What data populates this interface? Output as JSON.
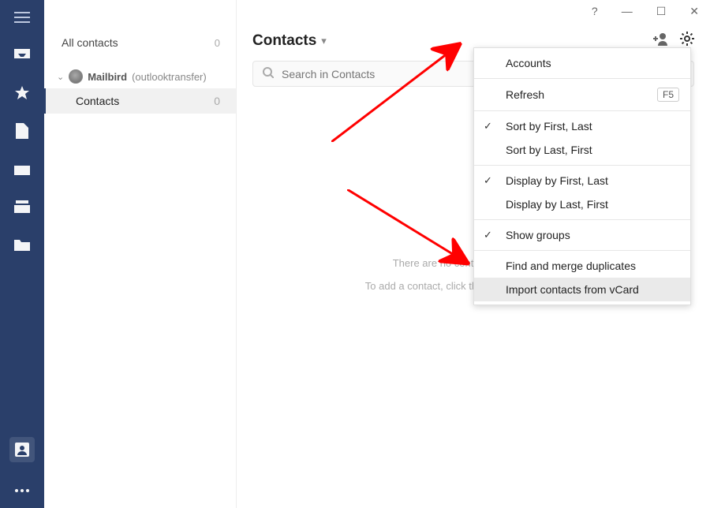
{
  "window": {
    "help": "?",
    "min": "—",
    "max": "☐",
    "close": "✕"
  },
  "sidebar": {
    "all": {
      "label": "All contacts",
      "count": "0"
    },
    "account": {
      "name": "Mailbird",
      "anno": "(outlooktransfer)"
    },
    "item": {
      "label": "Contacts",
      "count": "0"
    }
  },
  "main": {
    "title": "Contacts",
    "search_placeholder": "Search in Contacts",
    "empty_line1": "There are no contacts in this group.",
    "empty_line2": "To add a contact, click the \"Add contact\" button."
  },
  "menu": {
    "accounts": "Accounts",
    "refresh": {
      "label": "Refresh",
      "shortcut": "F5"
    },
    "sort_fl": "Sort by First, Last",
    "sort_lf": "Sort by Last, First",
    "disp_fl": "Display by First, Last",
    "disp_lf": "Display by Last, First",
    "show_groups": "Show groups",
    "merge": "Find and merge duplicates",
    "import": "Import contacts from vCard"
  }
}
